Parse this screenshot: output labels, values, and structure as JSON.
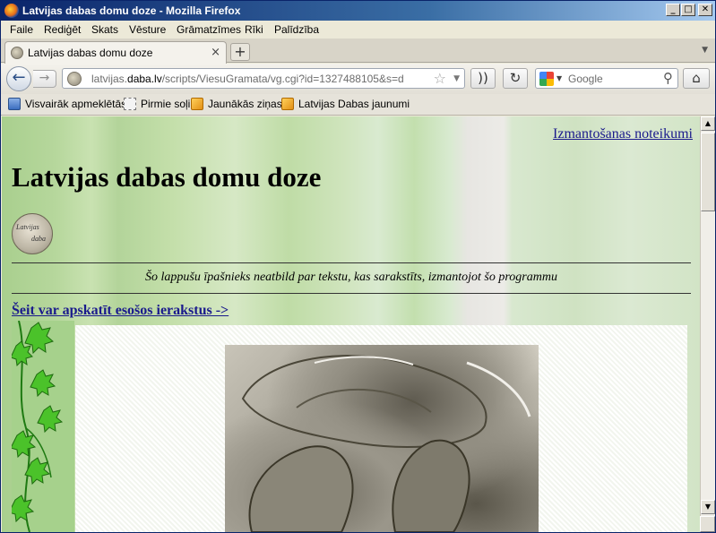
{
  "window": {
    "title": "Latvijas dabas domu doze - Mozilla Firefox",
    "minimize_glyph": "_",
    "maximize_glyph": "□",
    "close_glyph": "✕"
  },
  "menu": [
    "Faile",
    "Rediģēt",
    "Skats",
    "Vēsture",
    "Grāmatzīmes",
    "Rīki",
    "Palīdzība"
  ],
  "tab": {
    "label": "Latvijas dabas domu doze",
    "close_glyph": "×"
  },
  "newtab_glyph": "+",
  "url": {
    "prefix": "latvijas.",
    "domain": "daba.lv",
    "path": "/scripts/ViesuGramata/vg.cgi?id=1327488105&s=d"
  },
  "search": {
    "placeholder": "Google"
  },
  "bookmarks": [
    {
      "label": "Visvairāk apmeklētās",
      "icon": "most-visited-icon"
    },
    {
      "label": "Pirmie soļi",
      "icon": "blank-page-icon"
    },
    {
      "label": "Jaunākās ziņas",
      "icon": "rss-icon"
    },
    {
      "label": "Latvijas Dabas jaunumi",
      "icon": "rss-icon"
    }
  ],
  "page": {
    "terms_link": "Izmantošanas noteikumi",
    "title": "Latvijas dabas domu doze",
    "logo_text_1": "Latvijas",
    "logo_text_2": "daba",
    "disclaimer": "Šo lappušu īpašnieks neatbild par tekstu, kas sarakstīts, izmantojot šo programmu",
    "entries_link": "Šeit var apskatīt esošos ierakstus ->"
  },
  "colors": {
    "link": "#1a1a8c",
    "page_green": "#a9cf8e",
    "vine_leaf": "#4bc22a"
  }
}
